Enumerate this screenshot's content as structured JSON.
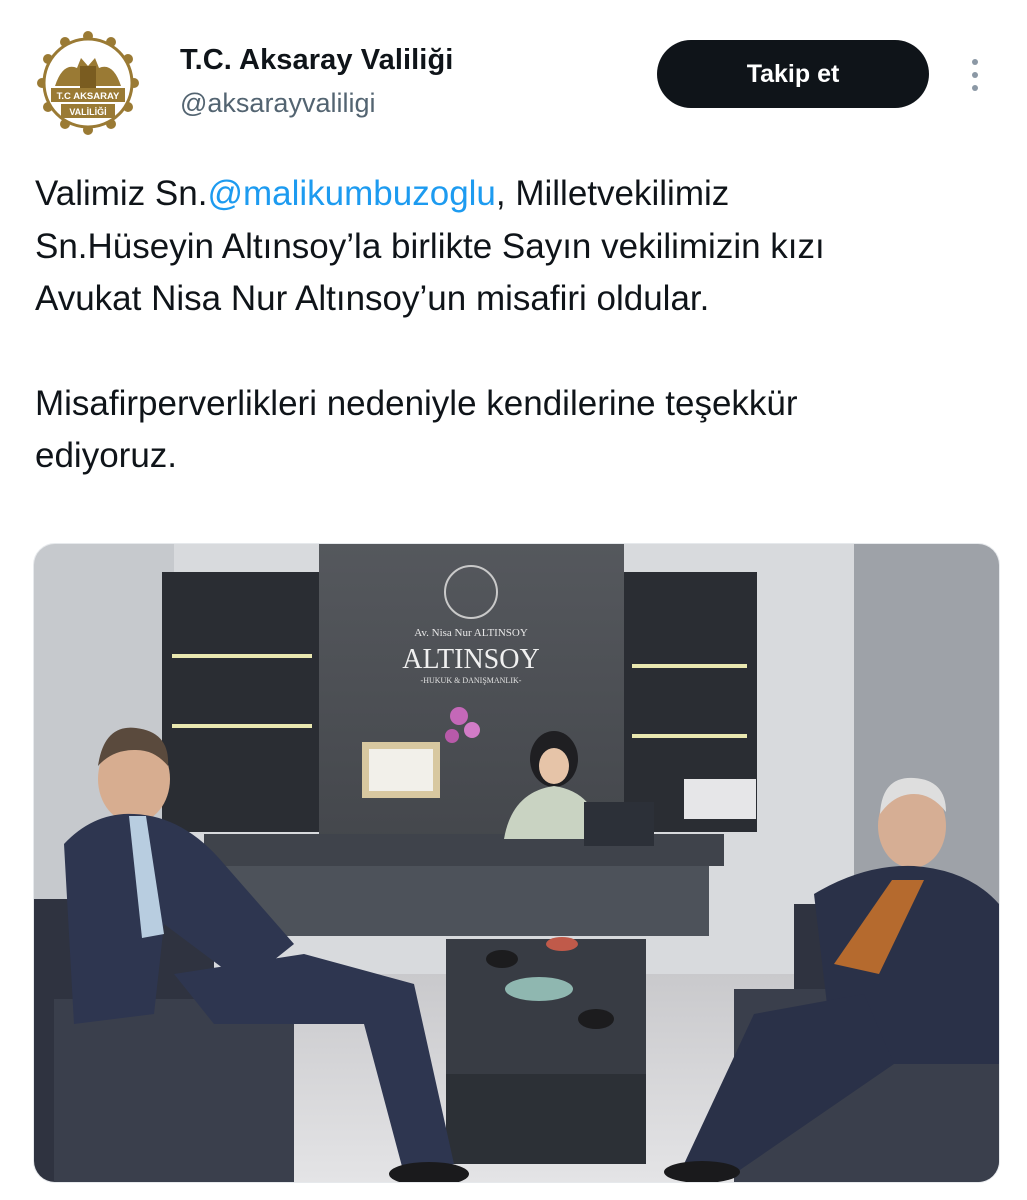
{
  "account": {
    "name": "T.C. Aksaray Valiliği",
    "handle": "@aksarayvaliligi",
    "avatar_text_top": "T.C AKSARAY",
    "avatar_text_bottom": "VALİLİĞİ"
  },
  "actions": {
    "follow_label": "Takip et",
    "more_icon": "more-vertical-icon"
  },
  "tweet": {
    "line1_prefix": "Valimiz Sn.",
    "mention": "@malikumbuzoglu",
    "line1_suffix": ", Milletvekilimiz",
    "line2": "Sn.Hüseyin Altınsoy’la birlikte Sayın vekilimizin kızı",
    "line3": "Avukat Nisa Nur Altınsoy’un misafiri oldular.",
    "line4": "Misafirperverlikleri nedeniyle kendilerine teşekkür",
    "line5": "ediyoruz."
  },
  "photo": {
    "sign_name": "Av. Nisa Nur ALTINSOY",
    "sign_brand": "ALTINSOY",
    "sign_sub": "-HUKUK & DANIŞMANLIK-"
  },
  "colors": {
    "accent": "#1d9bf0",
    "button_bg": "#0f1419",
    "handle_gray": "#536471",
    "logo_gold": "#9a7a34"
  }
}
